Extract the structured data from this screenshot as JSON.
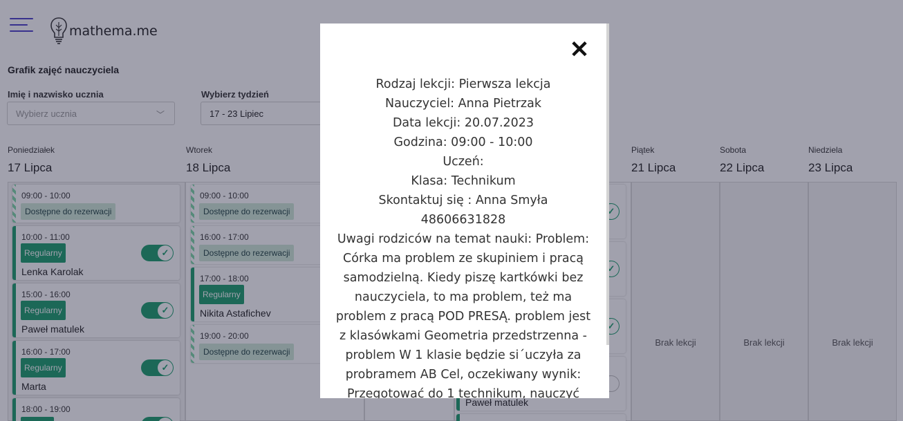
{
  "header": {
    "logo_text": "mathema.me",
    "page_title": "Grafik zajęć nauczyciela"
  },
  "filters": {
    "student_label": "Imię i nazwisko ucznia",
    "student_placeholder": "Wybierz ucznia",
    "week_label": "Wybierz tydzień",
    "week_value": "17 - 23 Lipiec"
  },
  "days": [
    {
      "name": "Poniedziałek",
      "date": "17 Lipca"
    },
    {
      "name": "Wtorek",
      "date": "18 Lipca"
    },
    {
      "name": "Piątek",
      "date": "21 Lipca"
    },
    {
      "name": "Sobota",
      "date": "22 Lipca"
    },
    {
      "name": "Niedziela",
      "date": "23 Lipca"
    }
  ],
  "empty_label": "Brak lekcji",
  "monday": [
    {
      "time": "09:00 - 10:00",
      "tag": "Dostępne do rezerwacji"
    },
    {
      "time": "10:00 - 11:00",
      "tag": "Regularny",
      "student": "Lenka Karolak",
      "toggle": true
    },
    {
      "time": "15:00 - 16:00",
      "tag": "Regularny",
      "student": "Paweł matulek",
      "toggle": true
    },
    {
      "time": "16:00 - 17:00",
      "tag": "Regularny",
      "student": "Marta",
      "toggle": true
    },
    {
      "time": "18:00 - 19:00"
    }
  ],
  "tuesday": [
    {
      "time": "09:00 - 10:00",
      "tag": "Dostępne do rezerwacji"
    },
    {
      "time": "16:00 - 17:00",
      "tag": "Dostępne do rezerwacji"
    },
    {
      "time": "17:00 - 18:00",
      "tag": "Regularny",
      "student": "Nikita Astafichev"
    },
    {
      "time": "19:00 - 20:00",
      "tag": "Dostępne do rezerwacji"
    }
  ],
  "thursday_partial": {
    "student": "Paweł matulek"
  },
  "modal": {
    "close_label": "✕",
    "lines": [
      "Rodzaj lekcji: Pierwsza lekcja",
      "Nauczyciel: Anna Pietrzak",
      "Data lekcji: 20.07.2023",
      "Godzina: 09:00 - 10:00",
      "Uczeń:",
      "Klasa: Technikum",
      "Skontaktuj się : Anna Smyła",
      "48606631828",
      "Uwagi rodziców na temat nauki: Problem: Córka ma problem ze skupiniem i pracą samodzielną. Kiedy piszę kartkówki bez nauczyciela, to ma problem, też ma problem z pracą POD PRESĄ. problem jest z klasówkami Geometria przedstrzenna - problem W 1 klasie będzie si´uczyła za probramem AB Cel, oczekiwany wynik: Przegotować do 1 technikum, nauczyć"
    ]
  },
  "colors": {
    "accent": "#1a9e6c",
    "available": "#cfe9d8",
    "hamburger": "#4b3fc9"
  }
}
